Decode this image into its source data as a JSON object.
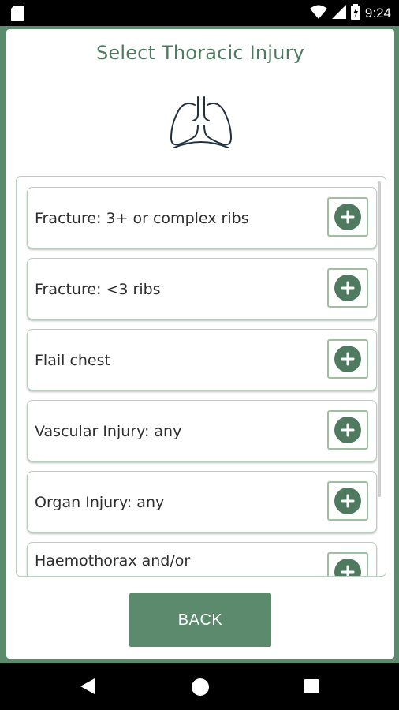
{
  "status_bar": {
    "time": "9:24",
    "icons": [
      "sd-card-icon",
      "wifi-icon",
      "signal-icon",
      "battery-icon"
    ]
  },
  "screen": {
    "title": "Select Thoracic Injury",
    "header_icon": "lungs-icon"
  },
  "injuries": [
    {
      "label": "Fracture: 3+ or complex ribs"
    },
    {
      "label": "Fracture: <3 ribs"
    },
    {
      "label": "Flail chest"
    },
    {
      "label": "Vascular Injury: any"
    },
    {
      "label": "Organ Injury: any"
    },
    {
      "label": "Haemothorax and/or"
    }
  ],
  "back_button": {
    "label": "BACK"
  },
  "colors": {
    "accent": "#5b8a6c",
    "title": "#4f7a60",
    "border": "#b7cfbd"
  },
  "nav_bar": {
    "icons": [
      "nav-back-icon",
      "nav-home-icon",
      "nav-recent-icon"
    ]
  }
}
